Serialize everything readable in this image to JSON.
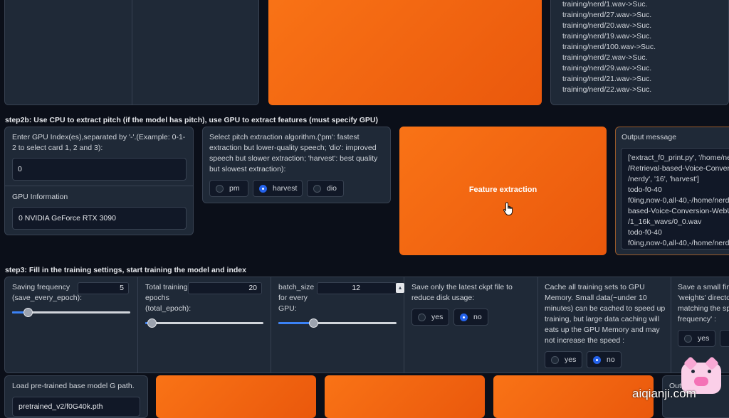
{
  "top_log": {
    "lines": [
      "training/nerd/1.wav->Suc.",
      "training/nerd/27.wav->Suc.",
      "training/nerd/20.wav->Suc.",
      "training/nerd/19.wav->Suc.",
      "training/nerd/100.wav->Suc.",
      "training/nerd/2.wav->Suc.",
      "training/nerd/29.wav->Suc.",
      "training/nerd/21.wav->Suc.",
      "training/nerd/22.wav->Suc."
    ]
  },
  "step2b": {
    "title": "step2b: Use CPU to extract pitch (if the model has pitch), use GPU to extract features (must specify GPU)",
    "gpu_index_label": "Enter GPU Index(es),separated by '-'.(Example: 0-1-2 to select card 1, 2 and 3):",
    "gpu_index_value": "0",
    "gpu_info_label": "GPU Information",
    "gpu_info_value": "0 NVIDIA GeForce RTX 3090",
    "pitch_label": "Select pitch extraction algorithm.('pm': fastest extraction but lower-quality speech; 'dio': improved speech but slower extraction; 'harvest': best quality but slowest extraction):",
    "pitch_options": [
      "pm",
      "harvest",
      "dio"
    ],
    "pitch_selected": "harvest",
    "feature_button": "Feature extraction",
    "output_label": "Output message",
    "output_lines": [
      "['extract_f0_print.py', '/home/ne",
      "/Retrieval-based-Voice-Conversio",
      "/nerdy', '16', 'harvest']",
      "todo-f0-40",
      "f0ing,now-0,all-40,-/home/nerdy",
      "based-Voice-Conversion-WebUI/",
      "/1_16k_wavs/0_0.wav",
      "todo-f0-40",
      "f0ing,now-0,all-40,-/home/nerdy"
    ]
  },
  "step3": {
    "title": "step3: Fill in the training settings, start training the model and index",
    "save_freq_label": "Saving frequency (save_every_epoch):",
    "save_freq_value": 5,
    "save_freq_max": 50,
    "total_epoch_label": "Total training epochs (total_epoch):",
    "total_epoch_value": 20,
    "total_epoch_max": 1000,
    "batch_label": "batch_size for every GPU:",
    "batch_value": 12,
    "batch_max": 40,
    "save_latest_label": "Save only the latest ckpt file to reduce disk usage:",
    "save_latest_options": [
      "yes",
      "no"
    ],
    "save_latest_selected": "no",
    "cache_label": "Cache all training sets to GPU Memory. Small data(~under 10 minutes) can be cached to speed up training, but large data caching will eats up the GPU Memory and may not increase the speed :",
    "cache_options": [
      "yes",
      "no"
    ],
    "cache_selected": "no",
    "small_final_label": "Save a small fini 'weights' directo matching the spe frequency' :",
    "small_final_options": [
      "yes"
    ],
    "pretrained_g_label": "Load pre-trained base model G path.",
    "pretrained_g_value": "pretrained_v2/f0G40k.pth",
    "partial_output_label": "Out"
  },
  "watermark": "aiqianji.com",
  "colors": {
    "accent": "#f97316",
    "radio_selected": "#2563eb",
    "background": "#0b0f19"
  }
}
